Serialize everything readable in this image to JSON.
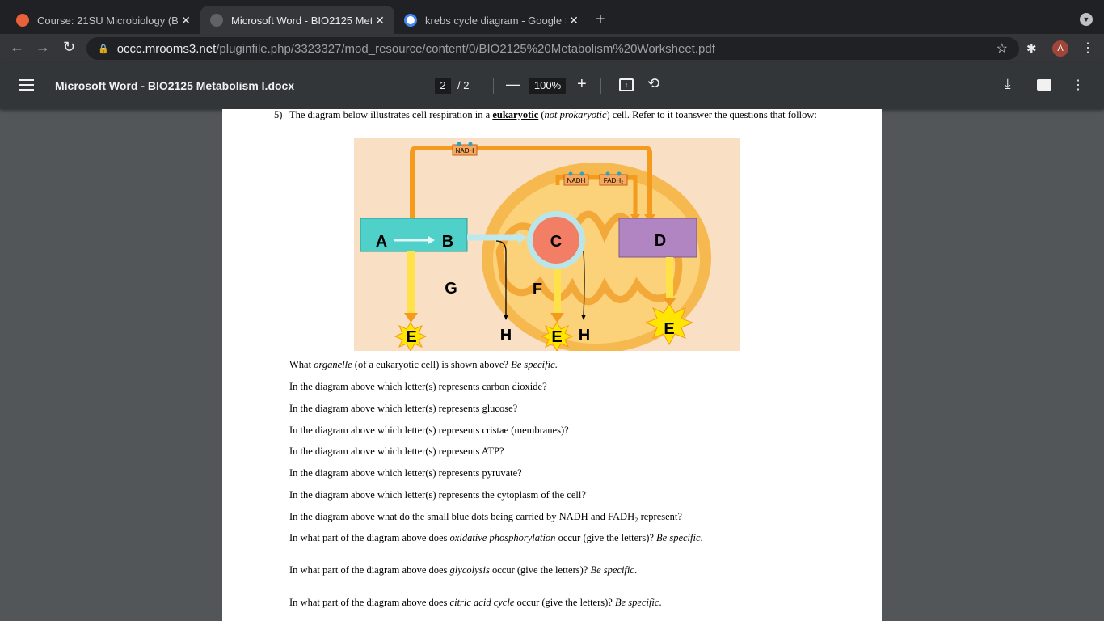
{
  "browser": {
    "tabs": [
      {
        "title": "Course: 21SU Microbiology (BI",
        "active": false
      },
      {
        "title": "Microsoft Word - BIO2125 Met",
        "active": true
      },
      {
        "title": "krebs cycle diagram - Google S",
        "active": false
      }
    ],
    "url_host": "occc.mrooms3.net",
    "url_path": "/pluginfile.php/3323327/mod_resource/content/0/BIO2125%20Metabolism%20Worksheet.pdf",
    "avatar_letter": "A"
  },
  "pdf_viewer": {
    "title": "Microsoft Word - BIO2125 Metabolism I.docx",
    "current_page": "2",
    "total_pages": "/ 2",
    "zoom": "100%"
  },
  "document": {
    "question_number": "5)",
    "intro_a": "The diagram below illustrates cell respiration in a ",
    "intro_b": "eukaryotic",
    "intro_c": " (",
    "intro_d": "not prokaryotic",
    "intro_e": ") cell. Refer to it toanswer the questions that follow:",
    "diagram_labels": {
      "a": "A",
      "b": "B",
      "c": "C",
      "d": "D",
      "e1": "E",
      "e2": "E",
      "e3": "E",
      "f": "F",
      "g": "G",
      "h1": "H",
      "h2": "H",
      "nadh_top": "NADH",
      "nadh_mid": "NADH",
      "fadh": "FADH₂"
    },
    "q_organelle": {
      "a": "What ",
      "b": "organelle",
      "c": " (of a eukaryotic cell) is shown above? ",
      "d": "Be specific",
      "e": "."
    },
    "q_co2": "In the diagram above which letter(s) represents carbon dioxide?",
    "q_glucose": "In the diagram above which letter(s) represents glucose?",
    "q_cristae": "In the diagram above which letter(s) represents cristae (membranes)?",
    "q_atp": "In the diagram above which letter(s) represents ATP?",
    "q_pyruvate": "In the diagram above which letter(s) represents pyruvate?",
    "q_cytoplasm": "In the diagram above which letter(s) represents the cytoplasm of the cell?",
    "q_dots": "In the diagram above what do the small blue dots being carried by NADH and FADH₂ represent?",
    "q_oxphos": {
      "a": "In what part of the diagram above does ",
      "b": "oxidative phosphorylation",
      "c": " occur (give the letters)? ",
      "d": "Be specific",
      "e": "."
    },
    "q_glycolysis": {
      "a": "In what part of the diagram above does ",
      "b": "glycolysis",
      "c": " occur (give the letters)? ",
      "d": "Be specific",
      "e": "."
    },
    "q_citric": {
      "a": "In what part of the diagram above does ",
      "b": "citric acid cycle",
      "c": " occur (give the letters)? ",
      "d": "Be specific",
      "e": "."
    }
  }
}
